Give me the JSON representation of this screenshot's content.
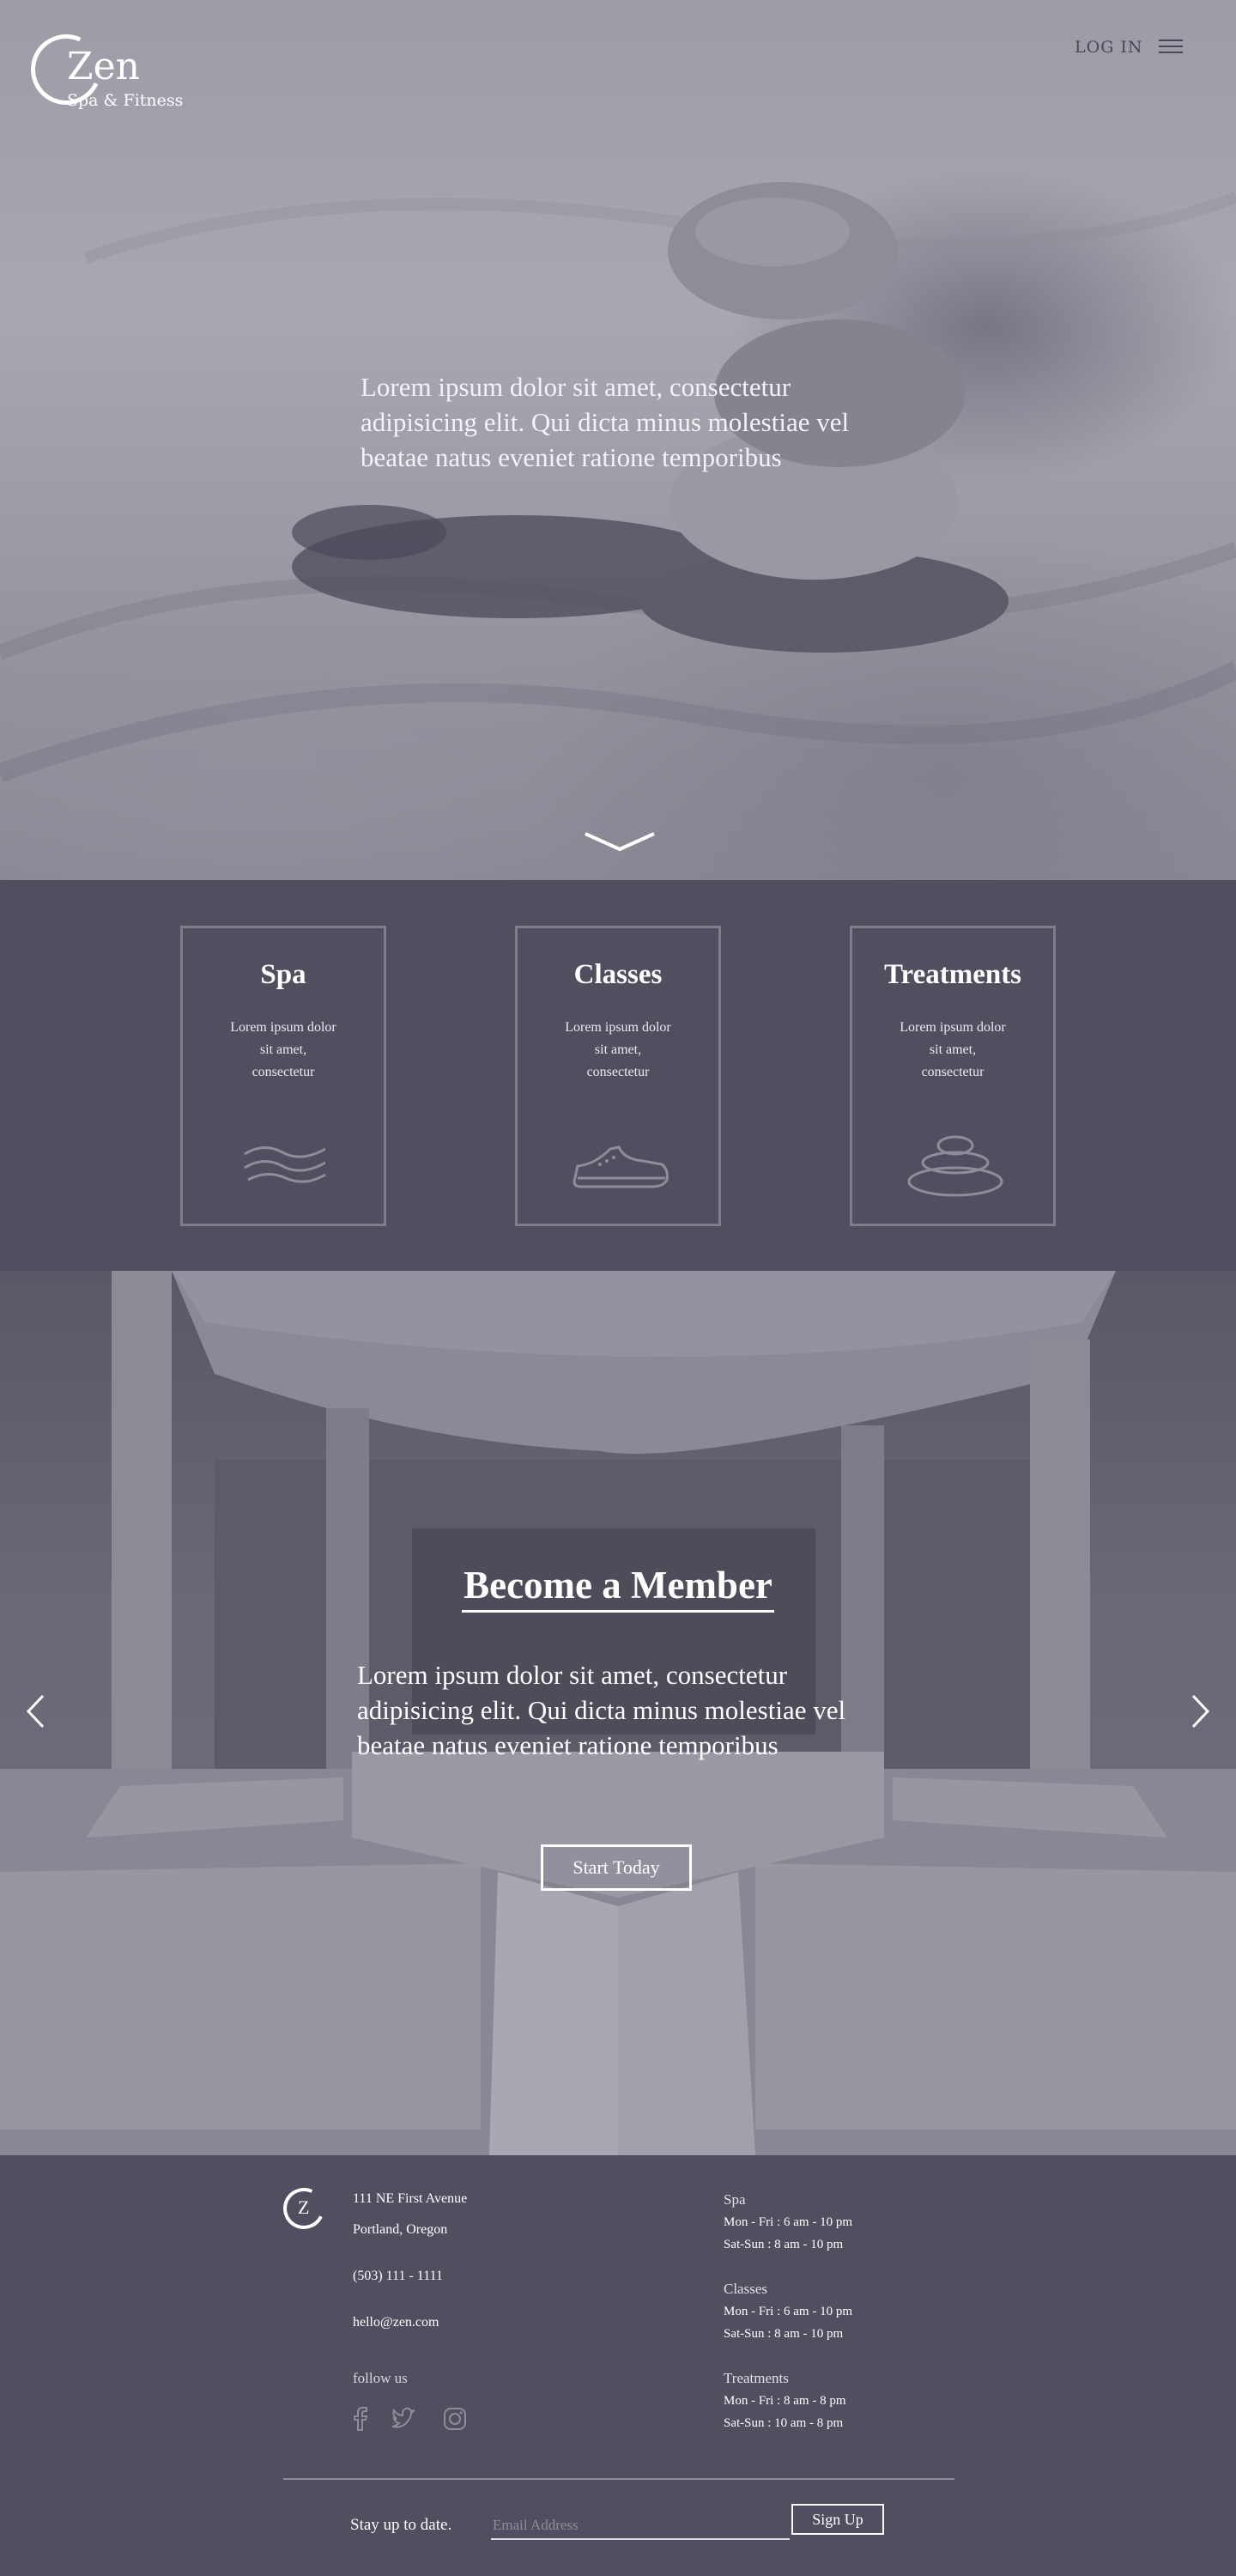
{
  "header": {
    "logo_name": "Zen",
    "logo_tagline": "Spa & Fitness",
    "login_label": "LOG IN",
    "menu_icon": "hamburger-icon"
  },
  "hero": {
    "text": "Lorem ipsum dolor sit amet, consectetur adipisicing elit. Qui dicta minus molestiae vel beatae natus eveniet ratione temporibus",
    "scroll_icon": "chevron-down-icon"
  },
  "services": [
    {
      "title": "Spa",
      "description": "Lorem ipsum dolor sit amet, consectetur",
      "icon": "waves-icon"
    },
    {
      "title": "Classes",
      "description": "Lorem ipsum dolor sit amet, consectetur",
      "icon": "sneaker-icon"
    },
    {
      "title": "Treatments",
      "description": "Lorem ipsum dolor sit amet, consectetur",
      "icon": "stones-icon"
    }
  ],
  "member": {
    "title": "Become a Member",
    "text": "Lorem ipsum dolor sit amet, consectetur adipisicing elit. Qui dicta minus molestiae vel beatae natus eveniet ratione temporibus",
    "cta_label": "Start Today",
    "prev_icon": "chevron-left-icon",
    "next_icon": "chevron-right-icon"
  },
  "footer": {
    "logo_letter": "Z",
    "address_line1": "111 NE First Avenue",
    "address_line2": "Portland, Oregon",
    "phone": "(503) 111 - 1111",
    "email": "hello@zen.com",
    "follow_label": "follow us",
    "social": [
      "facebook-icon",
      "twitter-icon",
      "instagram-icon"
    ],
    "hours": [
      {
        "name": "Spa",
        "weekday": "Mon - Fri :  6 am - 10 pm",
        "weekend": "Sat-Sun : 8 am - 10 pm"
      },
      {
        "name": "Classes",
        "weekday": "Mon - Fri :  6 am - 10 pm",
        "weekend": "Sat-Sun :  8 am - 10 pm"
      },
      {
        "name": "Treatments",
        "weekday": "Mon - Fri :  8 am - 8 pm",
        "weekend": "Sat-Sun :  10 am - 8 pm"
      }
    ],
    "newsletter": {
      "label": "Stay up to date.",
      "placeholder": "Email Address",
      "button_label": "Sign Up"
    }
  },
  "colors": {
    "panel": "#504e5f",
    "border": "#7f7d8c",
    "text": "#ffffff"
  }
}
